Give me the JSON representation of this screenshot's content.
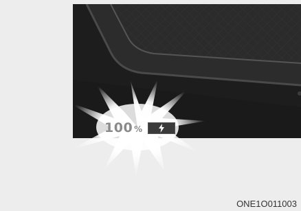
{
  "display": {
    "charge_value": "100",
    "charge_unit": "%",
    "charge_icon": "lightning-bolt-icon"
  },
  "figure": {
    "code": "ONE1O011003"
  },
  "colors": {
    "background": "#ededed",
    "photo_dark": "#1c1c1c",
    "glow": "#ffffff",
    "digits": "#8a8a8a",
    "charge_box": "#3a3a3a"
  }
}
